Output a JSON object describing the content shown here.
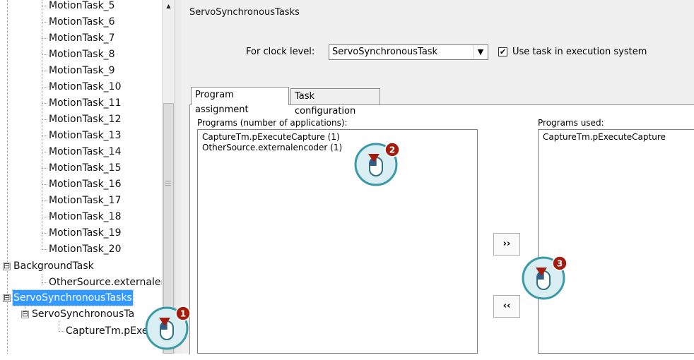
{
  "tree": {
    "items": [
      {
        "label": "MotionTask_5"
      },
      {
        "label": "MotionTask_6"
      },
      {
        "label": "MotionTask_7"
      },
      {
        "label": "MotionTask_8"
      },
      {
        "label": "MotionTask_9"
      },
      {
        "label": "MotionTask_10"
      },
      {
        "label": "MotionTask_11"
      },
      {
        "label": "MotionTask_12"
      },
      {
        "label": "MotionTask_13"
      },
      {
        "label": "MotionTask_14"
      },
      {
        "label": "MotionTask_15"
      },
      {
        "label": "MotionTask_16"
      },
      {
        "label": "MotionTask_17"
      },
      {
        "label": "MotionTask_18"
      },
      {
        "label": "MotionTask_19"
      },
      {
        "label": "MotionTask_20"
      },
      {
        "label": "BackgroundTask",
        "expander": "⊟"
      },
      {
        "label": "OtherSource.externalen"
      },
      {
        "label": "ServoSynchronousTasks",
        "expander": "⊟",
        "selected": true
      },
      {
        "label": "ServoSynchronousTa",
        "expander": "⊟"
      },
      {
        "label": "CaptureTm.pExe"
      }
    ]
  },
  "panel": {
    "title": "ServoSynchronousTasks",
    "clock_label": "For clock level:",
    "clock_value": "ServoSynchronousTask",
    "use_task_checked": "✔",
    "use_task_label": "Use task in execution system",
    "tabs": [
      {
        "label": "Program assignment",
        "active": true
      },
      {
        "label": "Task configuration",
        "active": false
      }
    ],
    "programs_label": "Programs (number of applications):",
    "programs": [
      "CaptureTm.pExecuteCapture  (1)",
      "OtherSource.externalencoder  (1)"
    ],
    "programs_used_label": "Programs used:",
    "programs_used": [
      "CaptureTm.pExecuteCapture"
    ],
    "add_label": "››",
    "remove_label": "‹‹"
  },
  "callouts": [
    {
      "number": "1"
    },
    {
      "number": "2"
    },
    {
      "number": "3"
    }
  ],
  "colors": {
    "selection": "#3399ff",
    "callout_fill": "#d8eef2",
    "callout_stroke": "#3a9aa8",
    "callout_badge": "#a31d0e"
  }
}
